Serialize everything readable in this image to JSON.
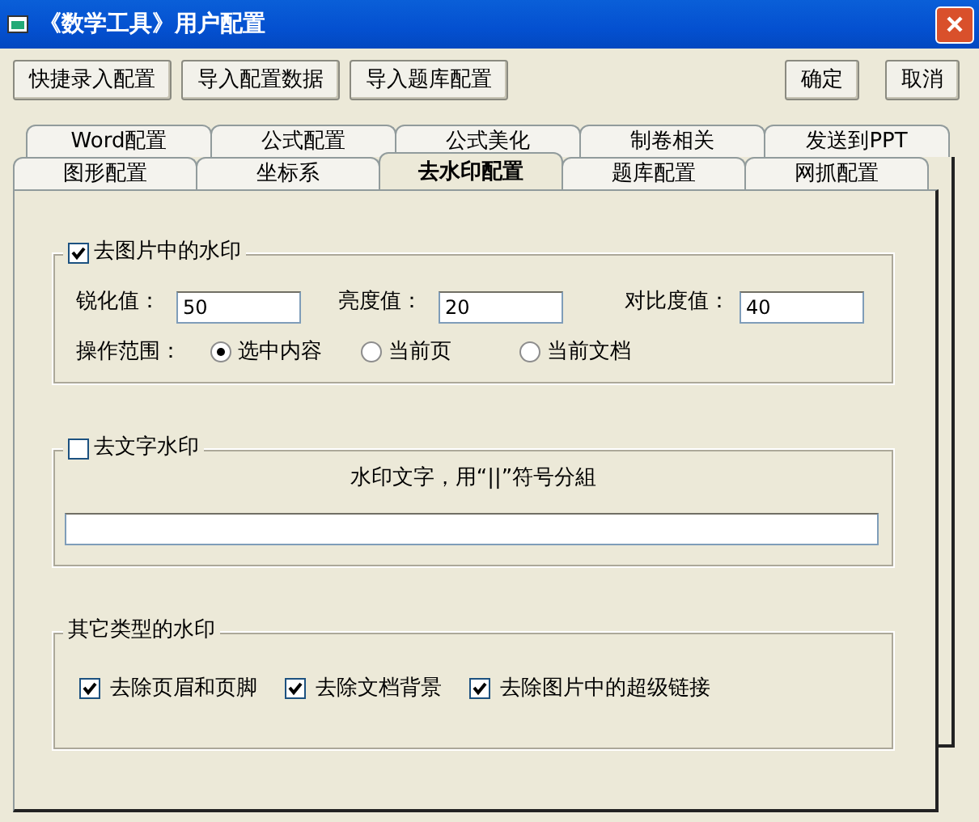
{
  "window": {
    "title": "《数学工具》用户配置"
  },
  "toolbar_buttons": [
    {
      "label": "快捷录入配置"
    },
    {
      "label": "导入配置数据"
    },
    {
      "label": "导入题库配置"
    }
  ],
  "dialog_buttons": [
    {
      "label": "确定"
    },
    {
      "label": "取消"
    }
  ],
  "tab_rows": [
    [
      {
        "label": "Word配置",
        "selected": false
      },
      {
        "label": "公式配置",
        "selected": false
      },
      {
        "label": "公式美化",
        "selected": false
      },
      {
        "label": "制卷相关",
        "selected": false
      },
      {
        "label": "发送到PPT",
        "selected": false
      }
    ],
    [
      {
        "label": "图形配置",
        "selected": false
      },
      {
        "label": "坐标系",
        "selected": false
      },
      {
        "label": "去水印配置",
        "selected": true
      },
      {
        "label": "题库配置",
        "selected": false
      },
      {
        "label": "网抓配置",
        "selected": false
      }
    ]
  ],
  "picture_watermark": {
    "label": "去图片中的水印",
    "checked": true,
    "fields": [
      {
        "label": "锐化值：",
        "value": "50"
      },
      {
        "label": "亮度值：",
        "value": "20"
      },
      {
        "label": "对比度值：",
        "value": "40"
      }
    ],
    "scope": {
      "label": "操作范围：",
      "options": [
        {
          "label": "选中内容",
          "selected": true
        },
        {
          "label": "当前页",
          "selected": false
        },
        {
          "label": "当前文档",
          "selected": false
        }
      ]
    }
  },
  "text_watermark": {
    "label": "去文字水印",
    "checked": false,
    "hint": "水印文字，用“||”符号分組"
  },
  "other_watermarks": {
    "title": "其它类型的水印",
    "options": [
      {
        "label": "去除页眉和页脚",
        "checked": true
      },
      {
        "label": "去除文档背景",
        "checked": true
      },
      {
        "label": "去除图片中的超级链接",
        "checked": true
      }
    ]
  }
}
